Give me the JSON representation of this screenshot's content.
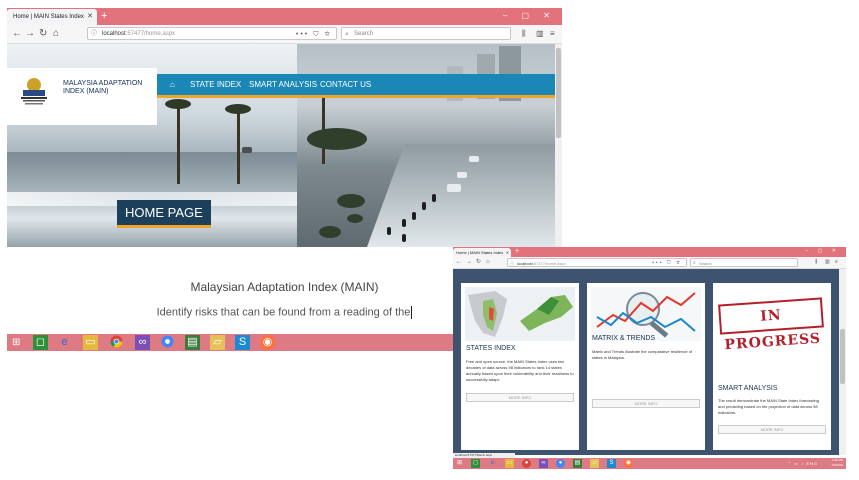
{
  "colors": {
    "tab_bar": "#e2737d",
    "nav_blue": "#1a87b7",
    "accent_orange": "#f0a52a",
    "title_navy": "#1c3f5c",
    "taskbar": "#de7a84",
    "card_bg_dark": "#3d5370",
    "stamp_red": "#b3202a"
  },
  "main_window": {
    "tab_title": "Home | MAIN States Index",
    "new_tab": "+",
    "window_controls": "–  ▢  ✕",
    "url_host": "localhost",
    "url_path": ":57477/home.aspx",
    "search_placeholder": "Search",
    "site": {
      "brand_name": "MALAYSIA ADAPTATION INDEX (MAIN)",
      "menu": [
        "STATE INDEX",
        "SMART ANALYSIS",
        "CONTACT US"
      ],
      "page_title": "HOME PAGE"
    },
    "section_title": "Malaysian Adaptation Index (MAIN)",
    "section_desc": "Identify risks that can be found from a reading of the",
    "taskbar_icons": [
      "start-icon",
      "store-icon",
      "ie-icon",
      "file-explorer-icon",
      "chrome-icon",
      "visual-studio-icon",
      "chrome-alt-icon",
      "project-icon",
      "folder-icon",
      "skype-icon",
      "firefox-icon"
    ]
  },
  "second_window": {
    "tab_title": "Home | MAIN States Index",
    "url_host": "localhost",
    "url_path": ":57477/home.aspx",
    "search_placeholder": "Search",
    "status_url": "localhost:57477/Matrix.aspx",
    "cards": [
      {
        "title": "STATES INDEX",
        "desc": "Free and open source, the MAIN States Index uses two decades of data across 98 indicators to rank 14 states annually based upon their vulnerability and their readiness to successfully adapt.",
        "button": "MORE INFO"
      },
      {
        "title": "MATRIX & TRENDS",
        "desc": "Matrix and Trends illustrate the comparative resilience of states in Malaysia.",
        "button": "MORE INFO"
      },
      {
        "title": "SMART ANALYSIS",
        "stamp": "IN PROGRESS",
        "desc": "The result demonstrate the MAIN State Index forecasting and predicting based on the projection of data across 98 indicators.",
        "button": "MORE INFO"
      }
    ],
    "clock_time": "4:50 PM",
    "clock_date": "7/2/2019",
    "lang": "ENG"
  }
}
